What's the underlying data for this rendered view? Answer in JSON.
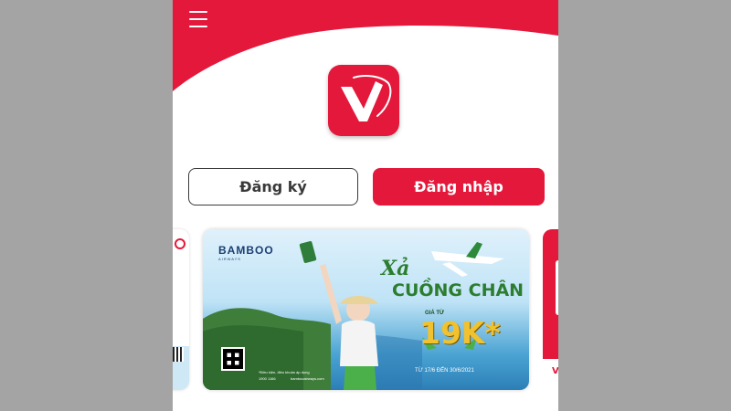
{
  "header": {
    "menu_icon": "hamburger-menu-icon",
    "logo_icon": "viettel-v-logo-icon",
    "brand_color": "#e4183b"
  },
  "auth": {
    "register_label": "Đăng ký",
    "login_label": "Đăng nhập"
  },
  "carousel": {
    "banner": {
      "brand": "BAMBOO",
      "brand_sub": "AIRWAYS",
      "headline_1": "Xả",
      "headline_2": "CUỒNG CHÂN",
      "price_label": "GIÁ TỪ",
      "price": "19K*",
      "dates": "TỪ 17/6 ĐẾN 30/6/2021",
      "note": "*Điều kiện, điều khoản áp dụng",
      "hotline": "1900 1166",
      "website": "bambooairways.com"
    }
  }
}
